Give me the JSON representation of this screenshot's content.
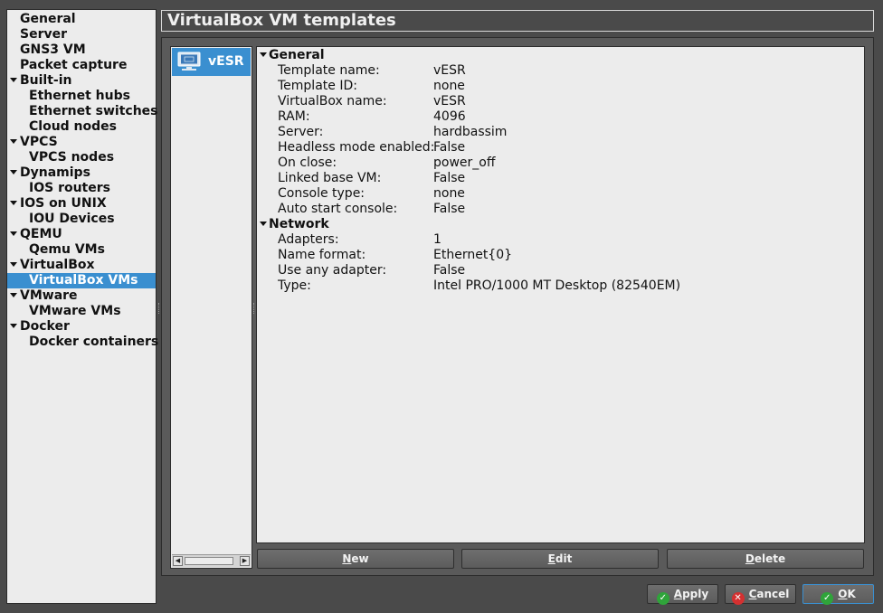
{
  "nav": {
    "items": [
      {
        "label": "General",
        "level": 0,
        "expandable": false,
        "selected": false
      },
      {
        "label": "Server",
        "level": 0,
        "expandable": false,
        "selected": false
      },
      {
        "label": "GNS3 VM",
        "level": 0,
        "expandable": false,
        "selected": false
      },
      {
        "label": "Packet capture",
        "level": 0,
        "expandable": false,
        "selected": false
      },
      {
        "label": "Built-in",
        "level": 0,
        "expandable": true,
        "selected": false
      },
      {
        "label": "Ethernet hubs",
        "level": 1,
        "expandable": false,
        "selected": false
      },
      {
        "label": "Ethernet switches",
        "level": 1,
        "expandable": false,
        "selected": false
      },
      {
        "label": "Cloud nodes",
        "level": 1,
        "expandable": false,
        "selected": false
      },
      {
        "label": "VPCS",
        "level": 0,
        "expandable": true,
        "selected": false
      },
      {
        "label": "VPCS nodes",
        "level": 1,
        "expandable": false,
        "selected": false
      },
      {
        "label": "Dynamips",
        "level": 0,
        "expandable": true,
        "selected": false
      },
      {
        "label": "IOS routers",
        "level": 1,
        "expandable": false,
        "selected": false
      },
      {
        "label": "IOS on UNIX",
        "level": 0,
        "expandable": true,
        "selected": false
      },
      {
        "label": "IOU Devices",
        "level": 1,
        "expandable": false,
        "selected": false
      },
      {
        "label": "QEMU",
        "level": 0,
        "expandable": true,
        "selected": false
      },
      {
        "label": "Qemu VMs",
        "level": 1,
        "expandable": false,
        "selected": false
      },
      {
        "label": "VirtualBox",
        "level": 0,
        "expandable": true,
        "selected": false
      },
      {
        "label": "VirtualBox VMs",
        "level": 1,
        "expandable": false,
        "selected": true
      },
      {
        "label": "VMware",
        "level": 0,
        "expandable": true,
        "selected": false
      },
      {
        "label": "VMware VMs",
        "level": 1,
        "expandable": false,
        "selected": false
      },
      {
        "label": "Docker",
        "level": 0,
        "expandable": true,
        "selected": false
      },
      {
        "label": "Docker containers",
        "level": 1,
        "expandable": false,
        "selected": false
      }
    ]
  },
  "page": {
    "title": "VirtualBox VM templates"
  },
  "vm_list": {
    "items": [
      {
        "label": "vESR",
        "icon": "virtualbox-vm-icon"
      }
    ]
  },
  "details": {
    "sections": [
      {
        "title": "General",
        "rows": [
          {
            "key": "Template name:",
            "value": "vESR"
          },
          {
            "key": "Template ID:",
            "value": "none"
          },
          {
            "key": "VirtualBox name:",
            "value": "vESR"
          },
          {
            "key": "RAM:",
            "value": "4096"
          },
          {
            "key": "Server:",
            "value": "hardbassim"
          },
          {
            "key": "Headless mode enabled:",
            "value": "False"
          },
          {
            "key": "On close:",
            "value": "power_off"
          },
          {
            "key": "Linked base VM:",
            "value": "False"
          },
          {
            "key": "Console type:",
            "value": "none"
          },
          {
            "key": "Auto start console:",
            "value": "False"
          }
        ]
      },
      {
        "title": "Network",
        "rows": [
          {
            "key": "Adapters:",
            "value": "1"
          },
          {
            "key": "Name format:",
            "value": "Ethernet{0}"
          },
          {
            "key": "Use any adapter:",
            "value": "False"
          },
          {
            "key": "Type:",
            "value": "Intel PRO/1000 MT Desktop (82540EM)"
          }
        ]
      }
    ]
  },
  "buttons": {
    "new": {
      "first": "N",
      "rest": "ew"
    },
    "edit": {
      "first": "E",
      "rest": "dit"
    },
    "delete": {
      "first": "D",
      "rest": "elete"
    },
    "apply": {
      "first": "A",
      "rest": "pply"
    },
    "cancel": {
      "first": "C",
      "rest": "ancel"
    },
    "ok": {
      "first": "O",
      "rest": "K"
    }
  },
  "colors": {
    "selection": "#3a8fd0",
    "background": "#4a4a4a",
    "panel": "#ececec"
  }
}
